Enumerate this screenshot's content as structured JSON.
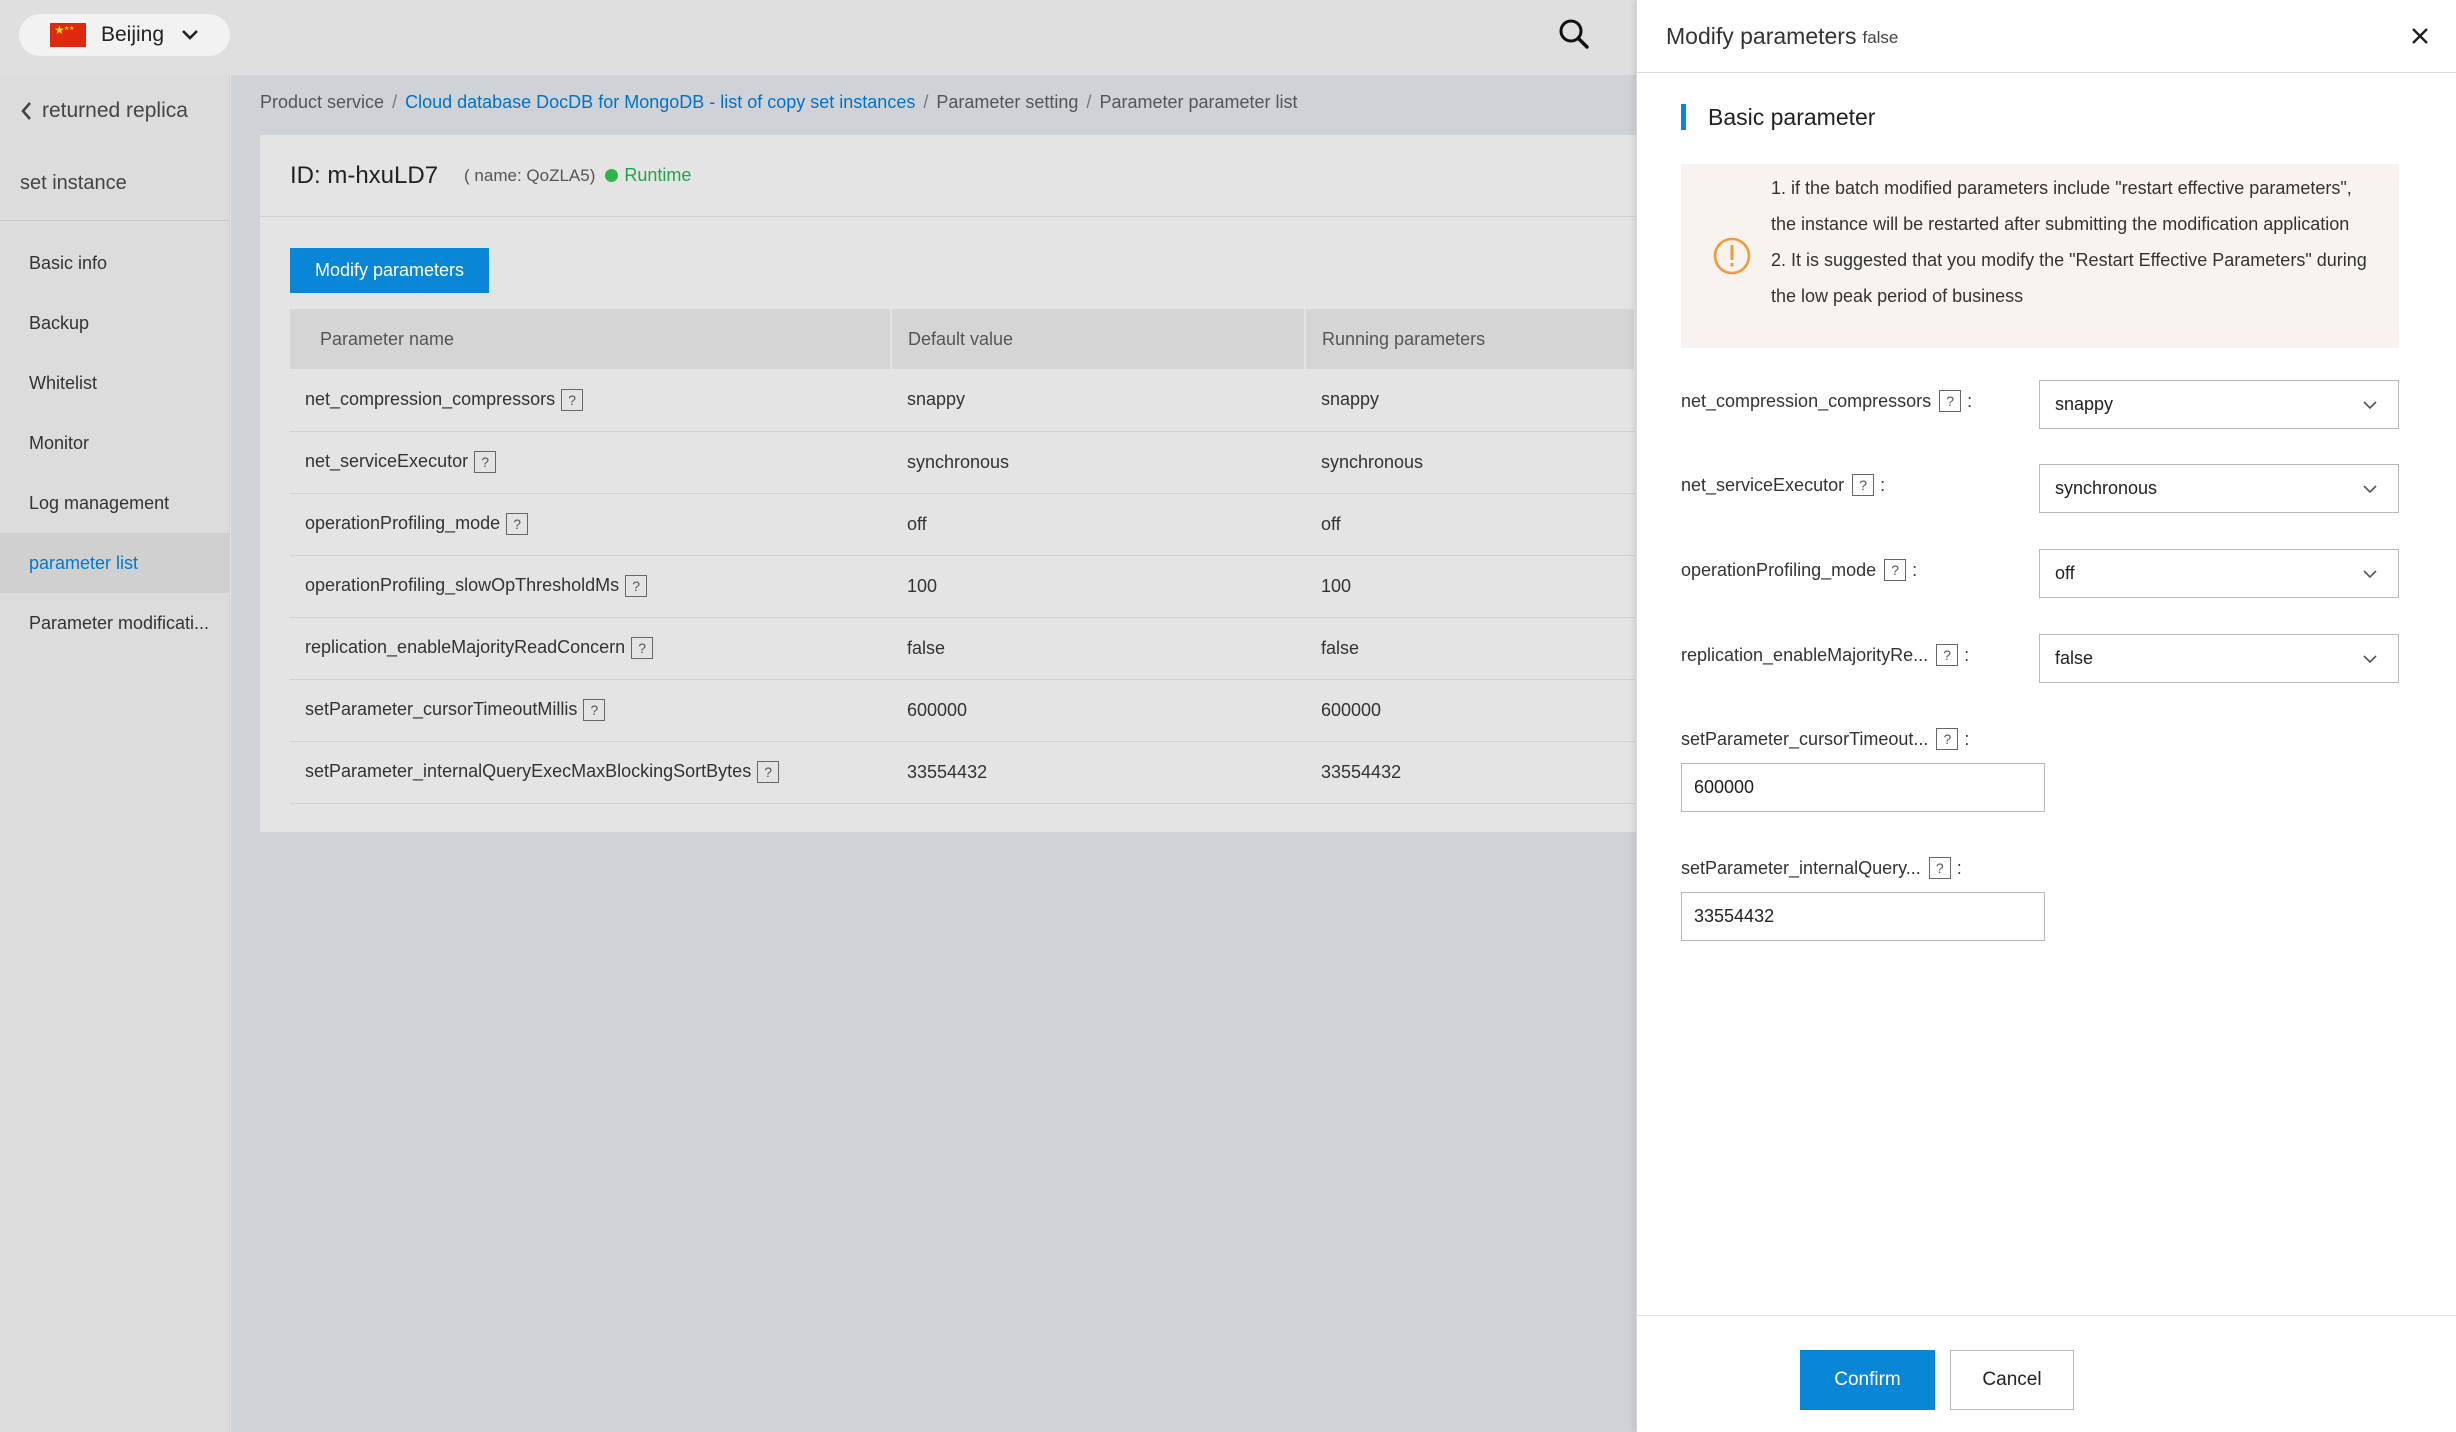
{
  "topbar": {
    "region": "Beijing",
    "region_flag": "china-flag-icon",
    "search_icon": "search-icon"
  },
  "sidebar": {
    "back_label": "returned replica",
    "subtitle": "set instance",
    "items": [
      {
        "label": "Basic info"
      },
      {
        "label": "Backup"
      },
      {
        "label": "Whitelist"
      },
      {
        "label": "Monitor"
      },
      {
        "label": "Log management"
      },
      {
        "label": "parameter list",
        "active": true
      },
      {
        "label": "Parameter modificati..."
      }
    ]
  },
  "breadcrumb": {
    "items": [
      "Product service",
      "Cloud database DocDB for MongoDB - list of copy set instances",
      "Parameter setting",
      "Parameter parameter list"
    ],
    "separator": "/"
  },
  "instance": {
    "id_label": "ID: m-hxuLD7",
    "name_label": "( name: QoZLA5)",
    "status": "Runtime",
    "status_color": "#2eb44b"
  },
  "main": {
    "modify_button": "Modify parameters",
    "help_glyph": "?",
    "table": {
      "headers": [
        "Parameter name",
        "Default value",
        "Running parameters"
      ],
      "rows": [
        [
          "net_compression_compressors",
          "snappy",
          "snappy"
        ],
        [
          "net_serviceExecutor",
          "synchronous",
          "synchronous"
        ],
        [
          "operationProfiling_mode",
          "off",
          "off"
        ],
        [
          "operationProfiling_slowOpThresholdMs",
          "100",
          "100"
        ],
        [
          "replication_enableMajorityReadConcern",
          "false",
          "false"
        ],
        [
          "setParameter_cursorTimeoutMillis",
          "600000",
          "600000"
        ],
        [
          "setParameter_internalQueryExecMaxBlockingSortBytes",
          "33554432",
          "33554432"
        ]
      ]
    }
  },
  "drawer": {
    "title": "Modify parameters",
    "title_tag": "false",
    "section_title": "Basic parameter",
    "notice": [
      "1. if the batch modified parameters include \"restart effective parameters\", the instance will be restarted after submitting the modification application",
      "2. It is suggested that you modify the \"Restart Effective Parameters\" during the low peak period of business"
    ],
    "fields": [
      {
        "label": "net_compression_compressors",
        "type": "select",
        "value": "snappy"
      },
      {
        "label": "net_serviceExecutor",
        "type": "select",
        "value": "synchronous"
      },
      {
        "label": "operationProfiling_mode",
        "type": "select",
        "value": "off"
      },
      {
        "label": "replication_enableMajorityRe...",
        "type": "select",
        "value": "false"
      },
      {
        "label": "setParameter_cursorTimeout...",
        "type": "input",
        "value": "600000"
      },
      {
        "label": "setParameter_internalQuery...",
        "type": "input",
        "value": "33554432"
      }
    ],
    "colon": ":",
    "confirm": "Confirm",
    "cancel": "Cancel"
  },
  "colors": {
    "accent": "#0a86d6",
    "warning": "#f29a3b"
  }
}
